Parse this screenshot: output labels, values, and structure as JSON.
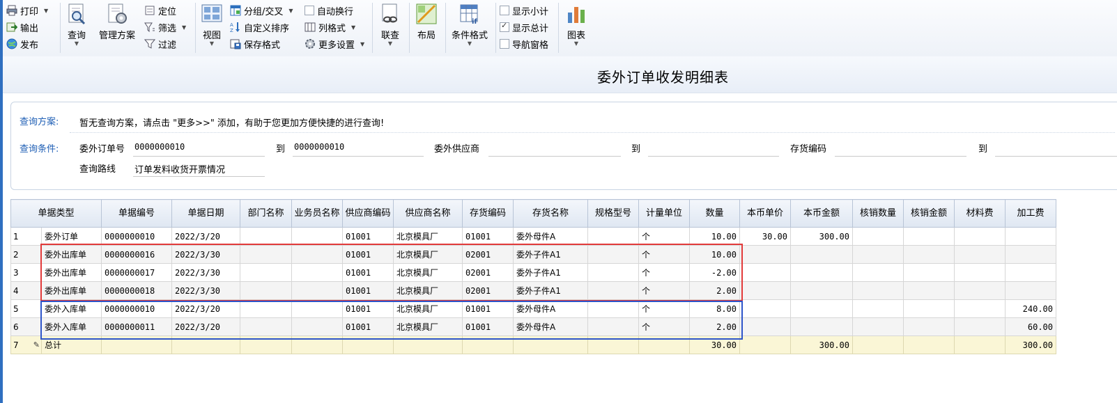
{
  "toolbar": {
    "print": "打印",
    "export": "输出",
    "publish": "发布",
    "query": "查询",
    "manage_scheme": "管理方案",
    "locate": "定位",
    "filter_screen": "筛选",
    "filter": "过滤",
    "view": "视图",
    "group_cross": "分组/交叉",
    "custom_sort": "自定义排序",
    "save_format": "保存格式",
    "auto_wrap": "自动换行",
    "column_format": "列格式",
    "more_settings": "更多设置",
    "link_query": "联查",
    "layout": "布局",
    "conditional_format": "条件格式",
    "show_subtotal": "显示小计",
    "show_total": "显示总计",
    "nav_pane": "导航窗格",
    "chart": "图表",
    "show_subtotal_checked": false,
    "show_total_checked": true,
    "nav_pane_checked": false,
    "auto_wrap_checked": false
  },
  "report_title": "委外订单收发明细表",
  "query": {
    "scheme_label": "查询方案:",
    "scheme_text": "暂无查询方案，请点击 \"更多>>\" 添加，有助于您更加方便快捷的进行查询!",
    "cond_label": "查询条件:",
    "order_no_label": "委外订单号",
    "order_no_from": "0000000010",
    "to1": "到",
    "order_no_to": "0000000010",
    "supplier_label": "委外供应商",
    "supplier_from": "",
    "to2": "到",
    "supplier_to": "",
    "inv_code_label": "存货编码",
    "inv_code_from": "",
    "to3": "到",
    "route_label": "查询路线",
    "route_value": "订单发料收货开票情况"
  },
  "grid": {
    "headers": [
      "单据类型",
      "单据编号",
      "单据日期",
      "部门名称",
      "业务员名称",
      "供应商编码",
      "供应商名称",
      "存货编码",
      "存货名称",
      "规格型号",
      "计量单位",
      "数量",
      "本币单价",
      "本币金额",
      "核销数量",
      "核销金额",
      "材料费",
      "加工费"
    ],
    "rows": [
      {
        "n": "1",
        "type": "委外订单",
        "no": "0000000010",
        "date": "2022/3/20",
        "dept": "",
        "sales": "",
        "sup_code": "01001",
        "sup_name": "北京模具厂",
        "inv_code": "01001",
        "inv_name": "委外母件A",
        "spec": "",
        "unit": "个",
        "qty": "10.00",
        "price": "30.00",
        "amount": "300.00",
        "wo_qty": "",
        "wo_amt": "",
        "mat": "",
        "proc": ""
      },
      {
        "n": "2",
        "type": "委外出库单",
        "no": "0000000016",
        "date": "2022/3/30",
        "dept": "",
        "sales": "",
        "sup_code": "01001",
        "sup_name": "北京模具厂",
        "inv_code": "02001",
        "inv_name": "委外子件A1",
        "spec": "",
        "unit": "个",
        "qty": "10.00",
        "price": "",
        "amount": "",
        "wo_qty": "",
        "wo_amt": "",
        "mat": "",
        "proc": ""
      },
      {
        "n": "3",
        "type": "委外出库单",
        "no": "0000000017",
        "date": "2022/3/30",
        "dept": "",
        "sales": "",
        "sup_code": "01001",
        "sup_name": "北京模具厂",
        "inv_code": "02001",
        "inv_name": "委外子件A1",
        "spec": "",
        "unit": "个",
        "qty": "-2.00",
        "price": "",
        "amount": "",
        "wo_qty": "",
        "wo_amt": "",
        "mat": "",
        "proc": ""
      },
      {
        "n": "4",
        "type": "委外出库单",
        "no": "0000000018",
        "date": "2022/3/30",
        "dept": "",
        "sales": "",
        "sup_code": "01001",
        "sup_name": "北京模具厂",
        "inv_code": "02001",
        "inv_name": "委外子件A1",
        "spec": "",
        "unit": "个",
        "qty": "2.00",
        "price": "",
        "amount": "",
        "wo_qty": "",
        "wo_amt": "",
        "mat": "",
        "proc": ""
      },
      {
        "n": "5",
        "type": "委外入库单",
        "no": "0000000010",
        "date": "2022/3/20",
        "dept": "",
        "sales": "",
        "sup_code": "01001",
        "sup_name": "北京模具厂",
        "inv_code": "01001",
        "inv_name": "委外母件A",
        "spec": "",
        "unit": "个",
        "qty": "8.00",
        "price": "",
        "amount": "",
        "wo_qty": "",
        "wo_amt": "",
        "mat": "",
        "proc": "240.00"
      },
      {
        "n": "6",
        "type": "委外入库单",
        "no": "0000000011",
        "date": "2022/3/20",
        "dept": "",
        "sales": "",
        "sup_code": "01001",
        "sup_name": "北京模具厂",
        "inv_code": "01001",
        "inv_name": "委外母件A",
        "spec": "",
        "unit": "个",
        "qty": "2.00",
        "price": "",
        "amount": "",
        "wo_qty": "",
        "wo_amt": "",
        "mat": "",
        "proc": "60.00"
      },
      {
        "n": "7",
        "type": "总计",
        "no": "",
        "date": "",
        "dept": "",
        "sales": "",
        "sup_code": "",
        "sup_name": "",
        "inv_code": "",
        "inv_name": "",
        "spec": "",
        "unit": "",
        "qty": "30.00",
        "price": "",
        "amount": "300.00",
        "wo_qty": "",
        "wo_amt": "",
        "mat": "",
        "proc": "300.00"
      }
    ]
  },
  "colors": {
    "accent": "#2f6fc0",
    "label_blue": "#1f5fb5",
    "highlight_red": "#e23a3a",
    "highlight_blue": "#2e55c9",
    "total_row": "#faf6d6"
  }
}
